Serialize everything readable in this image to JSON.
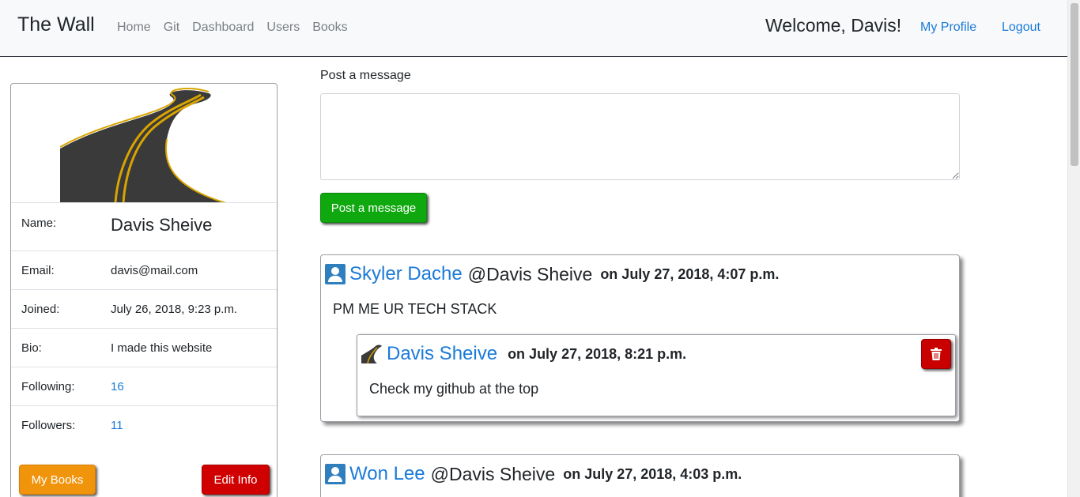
{
  "navbar": {
    "brand": "The Wall",
    "links": [
      "Home",
      "Git",
      "Dashboard",
      "Users",
      "Books"
    ],
    "welcome": "Welcome, Davis!",
    "profile_link": "My Profile",
    "logout_link": "Logout"
  },
  "profile": {
    "name_label": "Name:",
    "name": "Davis Sheive",
    "email_label": "Email:",
    "email": "davis@mail.com",
    "joined_label": "Joined:",
    "joined": "July 26, 2018, 9:23 p.m.",
    "bio_label": "Bio:",
    "bio": "I made this website",
    "following_label": "Following:",
    "following": "16",
    "followers_label": "Followers:",
    "followers": "11",
    "books_button": "My Books",
    "edit_button": "Edit Info"
  },
  "post_form": {
    "label": "Post a message",
    "textarea_value": "",
    "button": "Post a message"
  },
  "messages": [
    {
      "author": "Skyler Dache",
      "recipient": "@Davis Sheive",
      "timestamp": "on July 27, 2018, 4:07 p.m.",
      "body": "PM ME UR TECH STACK",
      "replies": [
        {
          "author": "Davis Sheive",
          "timestamp": "on July 27, 2018, 8:21 p.m.",
          "body": "Check my github at the top"
        }
      ]
    },
    {
      "author": "Won Lee",
      "recipient": "@Davis Sheive",
      "timestamp": "on July 27, 2018, 4:03 p.m."
    }
  ],
  "colors": {
    "link": "#1a7ad9",
    "post_button": "#0fa80f",
    "books_button": "#f0940c",
    "danger": "#d10000",
    "user_icon": "#2f7fbf"
  }
}
